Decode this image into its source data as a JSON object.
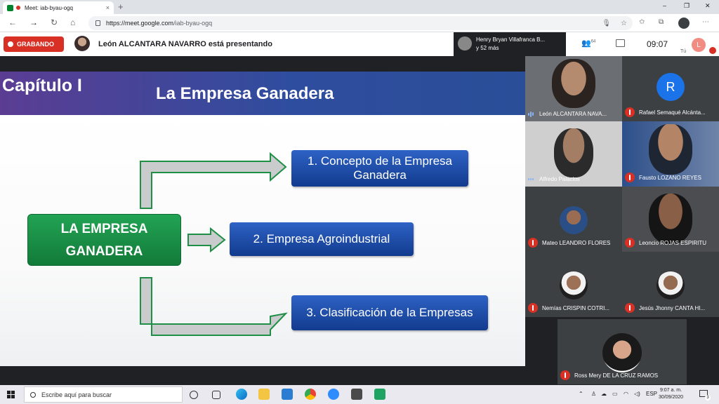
{
  "browser": {
    "tab_title": "Meet: iab-byau-ogq",
    "tab_close": "×",
    "new_tab": "+",
    "url_host": "https://meet.google.com",
    "url_path": "/iab-byau-ogq",
    "window_controls": [
      "–",
      "❐",
      "✕"
    ]
  },
  "meet": {
    "recording_label": "GRABANDO",
    "presenting_text": "León ALCANTARA NAVARRO está presentando",
    "others_line1": "Henry Bryan Villafranca B...",
    "others_line2": "y 52 más",
    "participants_count": "64",
    "time": "09:07",
    "self_initial": "L",
    "self_label": "Tú"
  },
  "slide": {
    "chapter": "Capítulo I",
    "title": "La Empresa Ganadera",
    "main_line1": "LA EMPRESA",
    "main_line2": "GANADERA",
    "topic1_line1": "1. Concepto de la Empresa",
    "topic1_line2": "Ganadera",
    "topic2": "2. Empresa Agroindustrial",
    "topic3": "3. Clasificación de la Empresas"
  },
  "participants": [
    {
      "name": "León ALCANTARA NAVA...",
      "mic": "on"
    },
    {
      "name": "Rafael Semaqué Alcánta...",
      "mic": "off",
      "initial": "R"
    },
    {
      "name": "Alfredo Palacios",
      "mic": "on"
    },
    {
      "name": "Fausto LOZANO REYES",
      "mic": "off"
    },
    {
      "name": "Mateo LEANDRO FLORES",
      "mic": "off"
    },
    {
      "name": "Leoncio ROJAS ESPIRITU",
      "mic": "off"
    },
    {
      "name": "Nemías CRISPIN COTRI...",
      "mic": "off"
    },
    {
      "name": "Jesús Jhonny CANTA HI...",
      "mic": "off"
    },
    {
      "name": "Ross Mery DE LA CRUZ RAMOS",
      "mic": "off"
    }
  ],
  "taskbar": {
    "search_placeholder": "Escribe aquí para buscar",
    "lang": "ESP",
    "time": "9:07 a. m.",
    "date": "30/09/2020",
    "notifications": "3"
  },
  "colors": {
    "record_red": "#d93025",
    "slide_header": "#3d4a9e",
    "main_box_green": "#1a8f45",
    "topic_blue": "#1f4ea8"
  }
}
